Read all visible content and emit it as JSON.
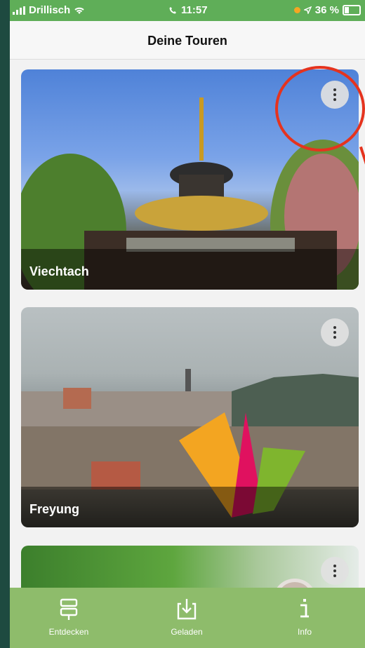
{
  "status": {
    "carrier": "Drillisch",
    "time": "11:57",
    "battery": "36 %"
  },
  "header": {
    "title": "Deine Touren"
  },
  "tours": [
    {
      "name": "Viechtach"
    },
    {
      "name": "Freyung"
    },
    {
      "name": ""
    }
  ],
  "tabbar": {
    "items": [
      {
        "label": "Entdecken",
        "icon": "signpost-icon"
      },
      {
        "label": "Geladen",
        "icon": "download-icon"
      },
      {
        "label": "Info",
        "icon": "info-icon"
      }
    ]
  },
  "colors": {
    "accent": "#8ebc6b",
    "status_bar": "#5fae58",
    "annotation": "#e5331e"
  }
}
